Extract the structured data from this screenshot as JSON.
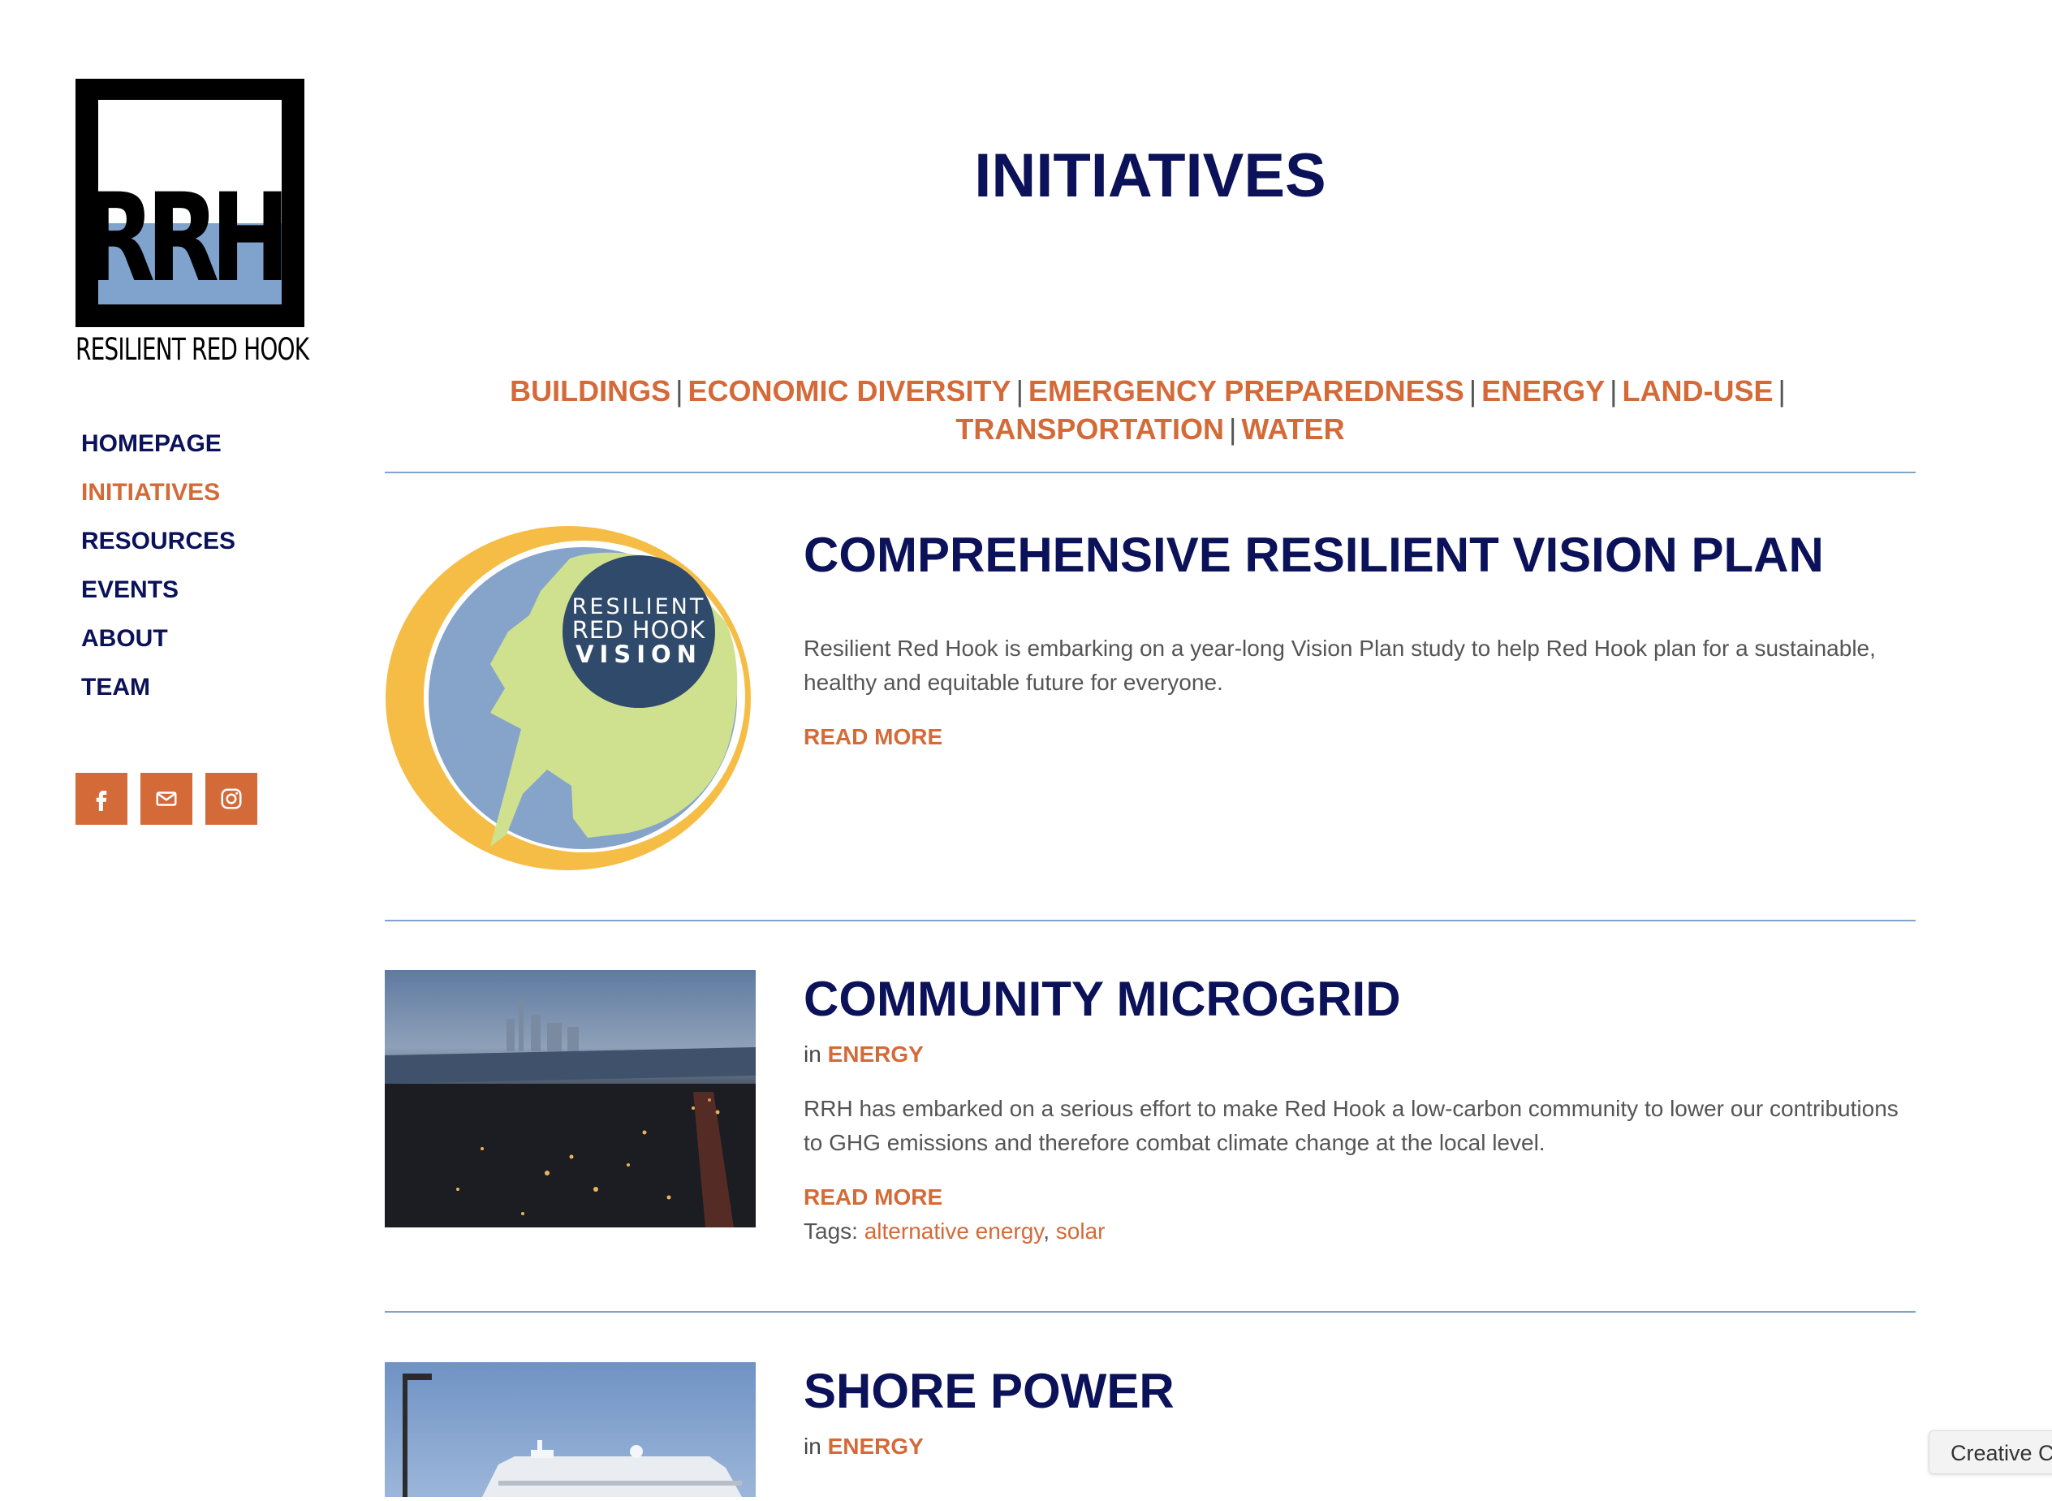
{
  "brand": {
    "letters": "RRH",
    "caption": "RESILIENT RED HOOK",
    "accent": "#d46a38",
    "navy": "#0b1259",
    "blue": "#7fa3cc"
  },
  "nav": [
    {
      "label": "HOMEPAGE",
      "active": false
    },
    {
      "label": "INITIATIVES",
      "active": true
    },
    {
      "label": "RESOURCES",
      "active": false
    },
    {
      "label": "EVENTS",
      "active": false
    },
    {
      "label": "ABOUT",
      "active": false
    },
    {
      "label": "TEAM",
      "active": false
    }
  ],
  "social": [
    {
      "icon": "facebook-icon"
    },
    {
      "icon": "mail-icon"
    },
    {
      "icon": "instagram-icon"
    }
  ],
  "page": {
    "title": "INITIATIVES"
  },
  "categories": [
    "BUILDINGS",
    "ECONOMIC DIVERSITY",
    "EMERGENCY PREPAREDNESS",
    "ENERGY",
    "LAND-USE",
    "TRANSPORTATION",
    "WATER"
  ],
  "category_separator": "|",
  "posts": [
    {
      "title": "COMPREHENSIVE RESILIENT VISION PLAN",
      "thumb_text": [
        "RESILIENT",
        "RED HOOK",
        "VISION"
      ],
      "excerpt": "Resilient Red Hook is embarking on a year-long Vision Plan study to help Red Hook plan for a sustainable, healthy and equitable future for everyone.",
      "read_more": "READ MORE"
    },
    {
      "title": "COMMUNITY MICROGRID",
      "meta_prefix": "in",
      "category": "ENERGY",
      "excerpt": "RRH has embarked on a serious effort to make Red Hook a low-carbon community to lower our contributions to GHG emissions and therefore combat climate change at the local level.",
      "read_more": "READ MORE",
      "tags_label": "Tags:",
      "tags": [
        "alternative energy",
        "solar"
      ],
      "tag_separator": ","
    },
    {
      "title": "SHORE POWER",
      "meta_prefix": "in",
      "category": "ENERGY"
    }
  ],
  "badge": {
    "text": "Creative C"
  }
}
